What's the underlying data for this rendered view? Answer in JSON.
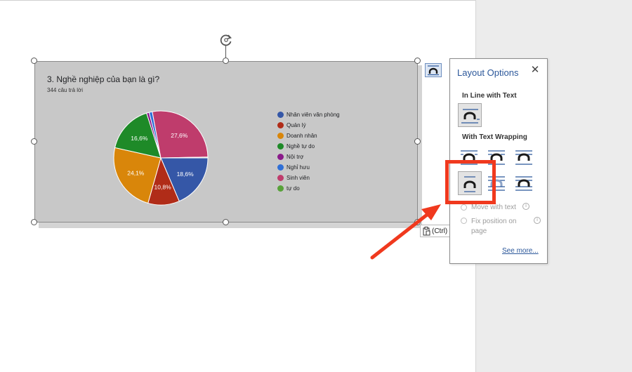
{
  "chart": {
    "title": "3. Nghề nghiệp của bạn là gì?",
    "subtitle": "344 câu trả lời"
  },
  "chart_data": {
    "type": "pie",
    "title": "3. Nghề nghiệp của bạn là gì?",
    "subtitle": "344 câu trả lời",
    "legend_position": "right",
    "slices": [
      {
        "label": "Nhân viên văn phòng",
        "value": 18.6,
        "color": "#3557a7",
        "data_label": "18,6%"
      },
      {
        "label": "Quản lý",
        "value": 10.8,
        "color": "#b02c18",
        "data_label": "10,8%"
      },
      {
        "label": "Doanh nhân",
        "value": 24.1,
        "color": "#d9860a",
        "data_label": "24,1%"
      },
      {
        "label": "Nghề tự do",
        "value": 16.6,
        "color": "#1e8a28",
        "data_label": "16,6%"
      },
      {
        "label": "Nội trợ",
        "value": 0.9,
        "color": "#8a1a8a",
        "data_label": ""
      },
      {
        "label": "Nghỉ hưu",
        "value": 1.1,
        "color": "#2f6fd6",
        "data_label": ""
      },
      {
        "label": "Sinh viên",
        "value": 27.6,
        "color": "#bf3c6c",
        "data_label": "27,6%"
      },
      {
        "label": "tự do",
        "value": 0.3,
        "color": "#58a23a",
        "data_label": ""
      }
    ]
  },
  "layout_options": {
    "title": "Layout Options",
    "close_icon": "close-icon",
    "inline_heading": "In Line with Text",
    "wrapping_heading": "With Text Wrapping",
    "move_with_text": "Move with text",
    "fix_position": "Fix position on page",
    "fix_position_line1": "Fix position on",
    "fix_position_line2": "page",
    "see_more": "See more...",
    "accent_color": "#2b579a"
  },
  "paste_options": {
    "label": "(Ctrl)",
    "icon": "clipboard-icon"
  },
  "annotation": {
    "highlight_color": "#f0391e"
  }
}
